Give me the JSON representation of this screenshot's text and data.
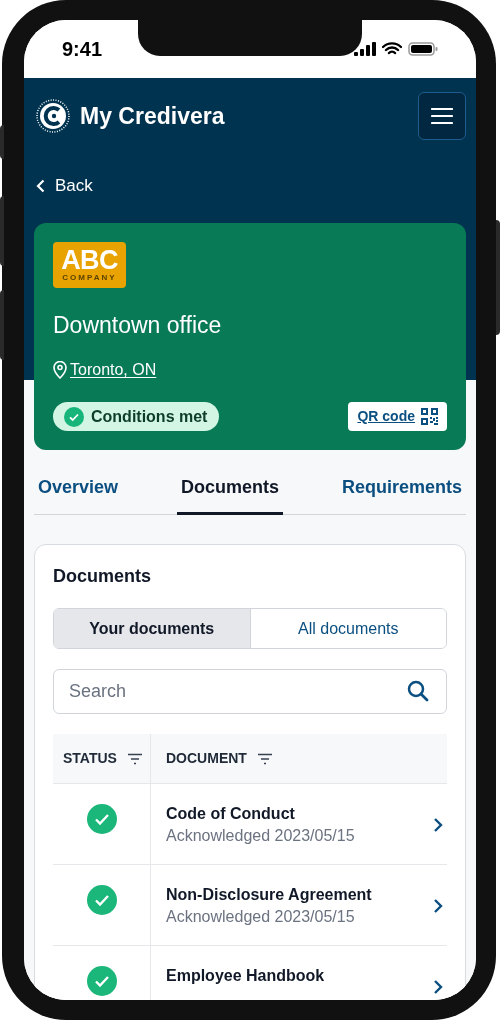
{
  "status_bar": {
    "time": "9:41"
  },
  "header": {
    "title": "My Credivera",
    "back": "Back"
  },
  "location_card": {
    "logo_main": "ABC",
    "logo_sub": "COMPANY",
    "title": "Downtown office",
    "location": "Toronto, ON",
    "status": {
      "label": "Conditions met",
      "met": true
    },
    "qr_button": "QR code"
  },
  "tabs": [
    {
      "label": "Overview",
      "selected": false
    },
    {
      "label": "Documents",
      "selected": true
    },
    {
      "label": "Requirements",
      "selected": false
    }
  ],
  "documents": {
    "title": "Documents",
    "segments": [
      {
        "label": "Your documents",
        "selected": true
      },
      {
        "label": "All documents",
        "selected": false
      }
    ],
    "search": {
      "placeholder": "Search"
    },
    "columns": [
      "STATUS",
      "DOCUMENT"
    ],
    "rows": [
      {
        "title": "Code of Conduct",
        "subtitle": "Acknowledged 2023/05/15",
        "done": true
      },
      {
        "title": "Non-Disclosure Agreement",
        "subtitle": "Acknowledged 2023/05/15",
        "done": true
      },
      {
        "title": "Employee Handbook",
        "done": true
      }
    ]
  }
}
